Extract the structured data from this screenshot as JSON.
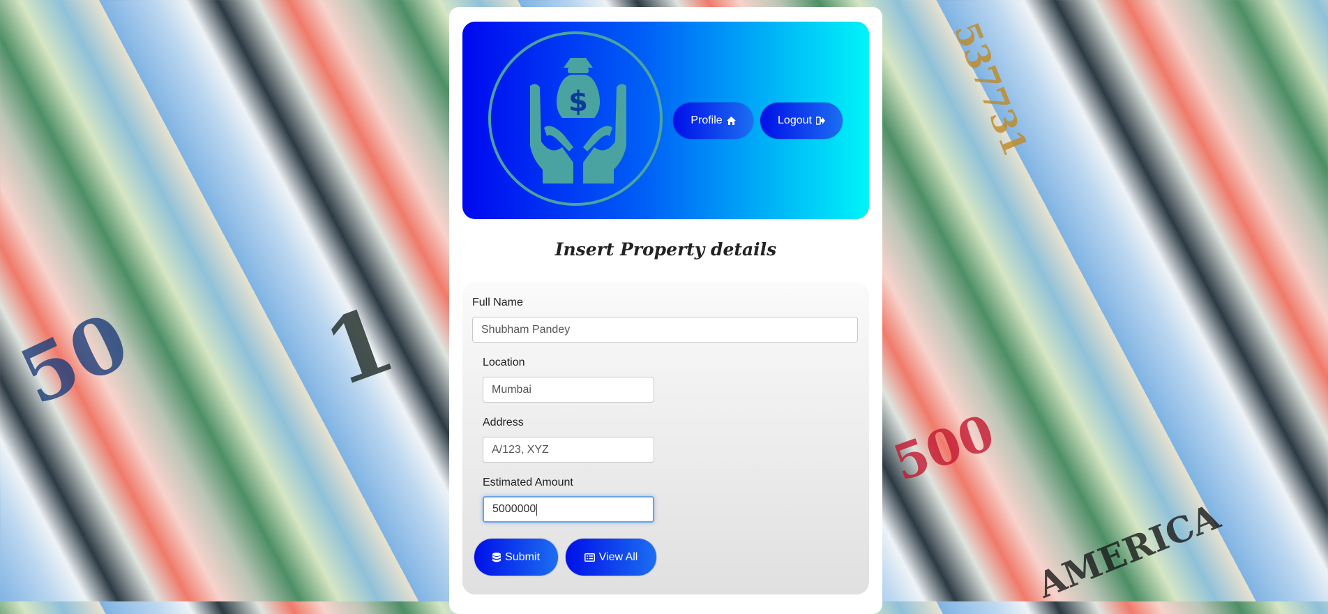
{
  "header": {
    "profile_label": "Profile",
    "logout_label": "Logout",
    "logo_icon": "money-bag-hands-icon"
  },
  "form": {
    "title": "Insert Property details",
    "full_name": {
      "label": "Full Name",
      "value": "Shubham Pandey"
    },
    "location": {
      "label": "Location",
      "value": "Mumbai"
    },
    "address": {
      "label": "Address",
      "value": "A/123, XYZ"
    },
    "estimated_amount": {
      "label": "Estimated Amount",
      "value": "5000000"
    },
    "submit_label": "Submit",
    "view_all_label": "View All"
  },
  "colors": {
    "banner_start": "#0008f0",
    "banner_end": "#00f4f8",
    "button": "#0010e8"
  }
}
